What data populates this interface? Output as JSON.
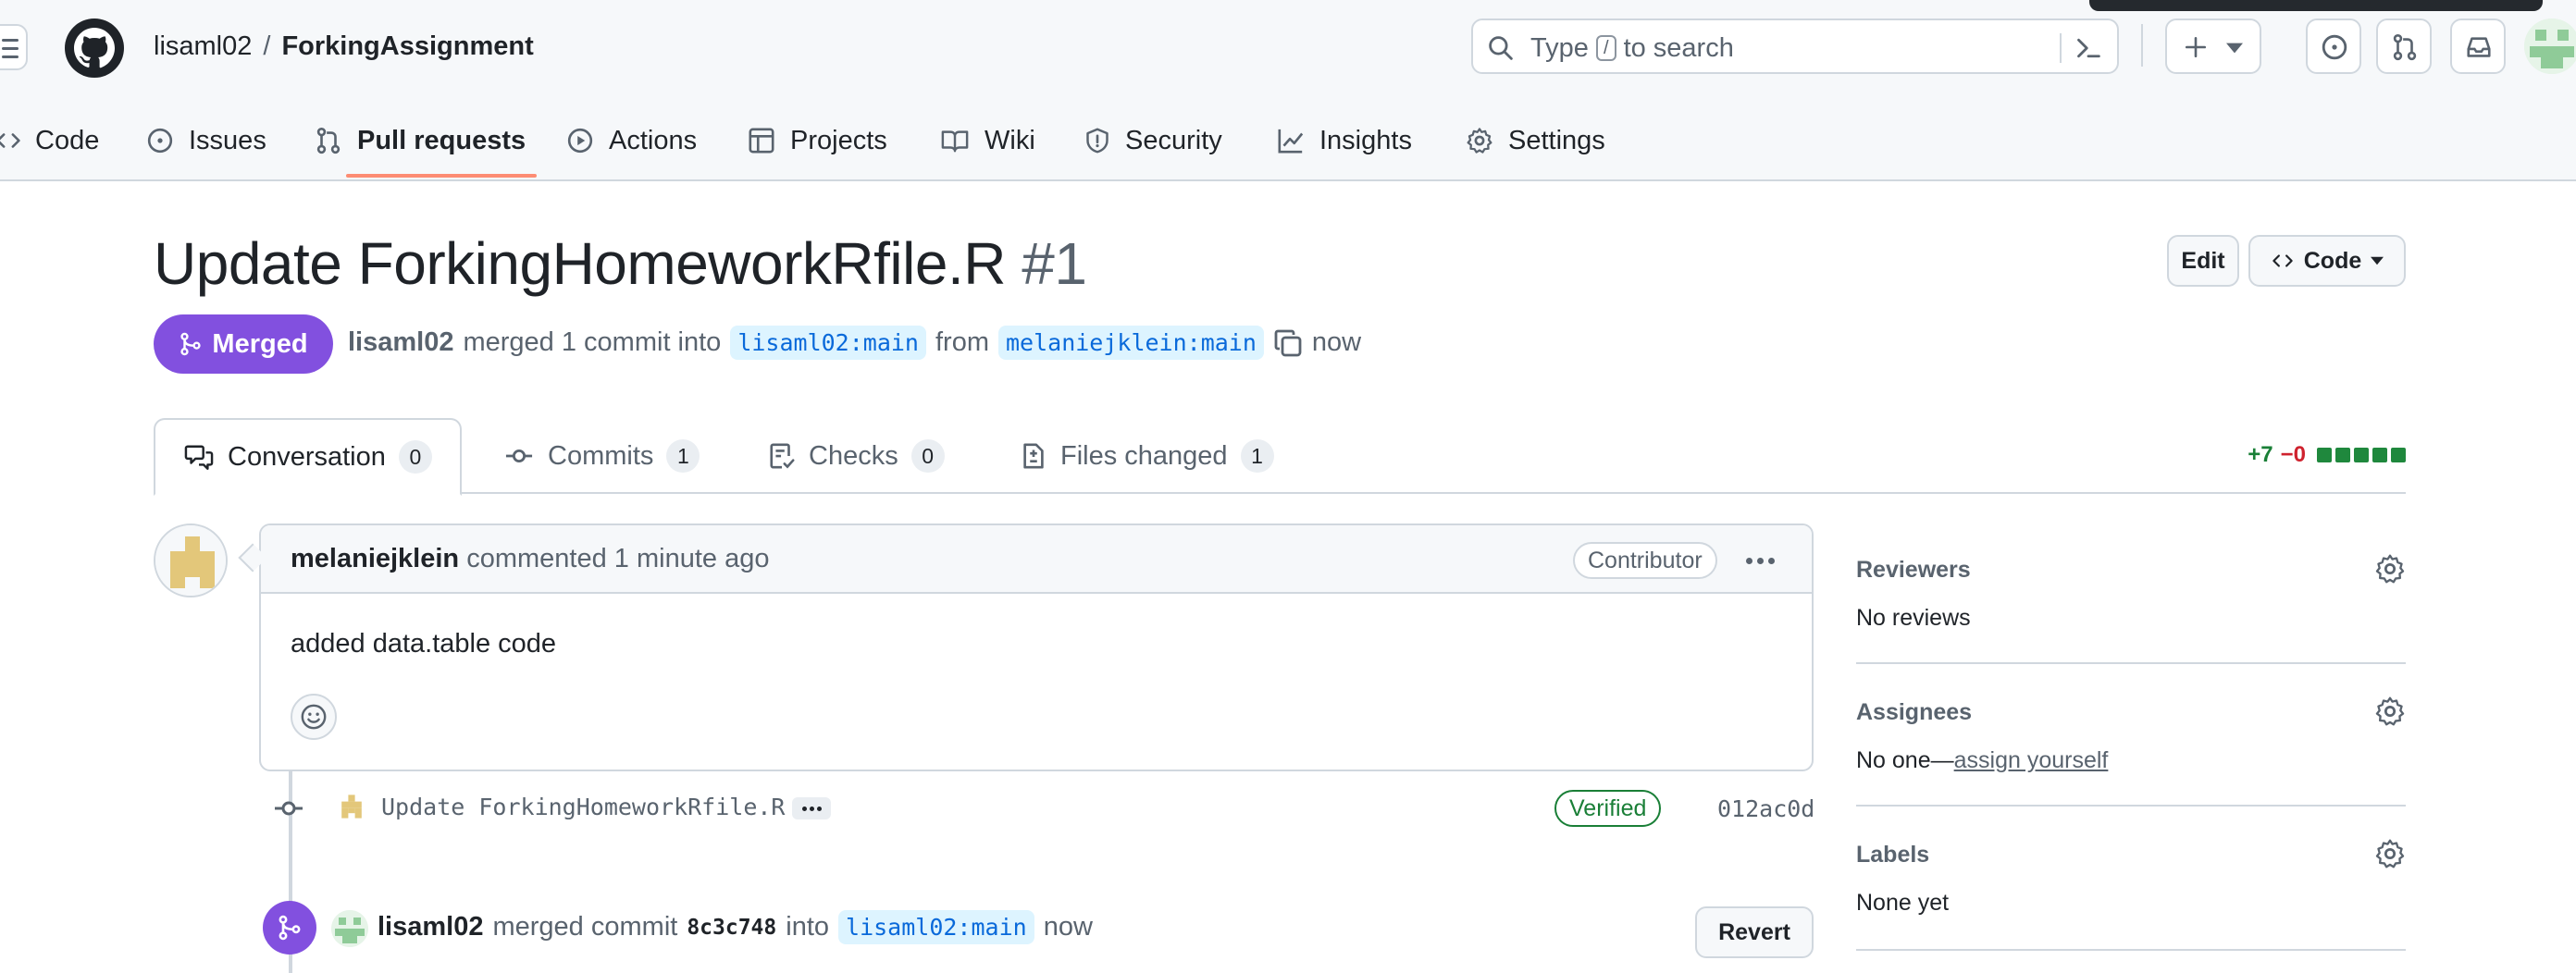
{
  "header": {
    "owner": "lisaml02",
    "separator": "/",
    "repo": "ForkingAssignment",
    "search": {
      "prefix": "Type",
      "key": "/",
      "suffix": "to search"
    },
    "icons": [
      "menu-icon",
      "github-logo",
      "search-icon",
      "command-palette-icon",
      "plus-icon",
      "issue-icon",
      "pull-request-icon",
      "inbox-icon"
    ]
  },
  "repo_nav": {
    "tabs": [
      {
        "label": "Code",
        "icon": "code-icon"
      },
      {
        "label": "Issues",
        "icon": "issue-icon"
      },
      {
        "label": "Pull requests",
        "icon": "pull-request-icon",
        "active": true
      },
      {
        "label": "Actions",
        "icon": "play-icon"
      },
      {
        "label": "Projects",
        "icon": "table-icon"
      },
      {
        "label": "Wiki",
        "icon": "book-icon"
      },
      {
        "label": "Security",
        "icon": "shield-icon"
      },
      {
        "label": "Insights",
        "icon": "graph-icon"
      },
      {
        "label": "Settings",
        "icon": "gear-icon"
      }
    ]
  },
  "pr": {
    "title": "Update ForkingHomeworkRfile.R",
    "number": "#1",
    "edit_label": "Edit",
    "code_label": "Code",
    "state": "Merged",
    "author": "lisaml02",
    "merge_text": "merged 1 commit into",
    "base_branch": "lisaml02:main",
    "from_text": "from",
    "head_branch": "melaniejklein:main",
    "time": "now"
  },
  "tabs": [
    {
      "label": "Conversation",
      "count": "0",
      "active": true
    },
    {
      "label": "Commits",
      "count": "1"
    },
    {
      "label": "Checks",
      "count": "0"
    },
    {
      "label": "Files changed",
      "count": "1"
    }
  ],
  "diffstat": {
    "additions": "+7",
    "deletions": "−0",
    "blocks": 5
  },
  "comment": {
    "author": "melaniejklein",
    "action": "commented 1 minute ago",
    "role": "Contributor",
    "body": "added data.table code"
  },
  "commit": {
    "message": "Update ForkingHomeworkRfile.R",
    "status": "Verified",
    "sha": "012ac0d"
  },
  "merge_event": {
    "actor": "lisaml02",
    "text": "merged commit",
    "sha": "8c3c748",
    "into_text": "into",
    "branch": "lisaml02:main",
    "time": "now",
    "revert_label": "Revert"
  },
  "sidebar": {
    "reviewers": {
      "title": "Reviewers",
      "value": "No reviews"
    },
    "assignees": {
      "title": "Assignees",
      "value": "No one—",
      "link": "assign yourself"
    },
    "labels": {
      "title": "Labels",
      "value": "None yet"
    }
  },
  "colors": {
    "merged": "#8250df",
    "link": "#0969da",
    "success": "#1a7f37",
    "danger": "#cf222e",
    "underline": "#fd8c73"
  }
}
